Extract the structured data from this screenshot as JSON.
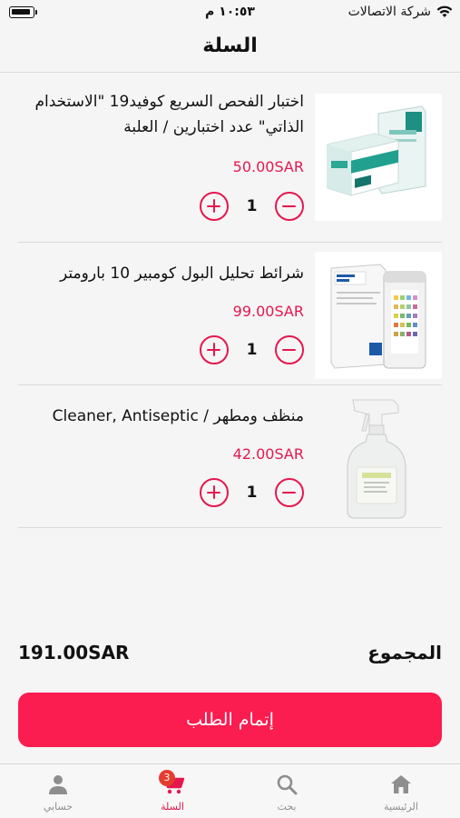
{
  "status_bar": {
    "carrier": "شركة الاتصالات",
    "time": "١٠:٥٣ م"
  },
  "header": {
    "title": "السلة"
  },
  "cart": {
    "items": [
      {
        "name": "اختبار الفحص السريع كوفيد19 \"الاستخدام الذاتي\"  عدد اختبارين / العلبة",
        "price": "50.00SAR",
        "quantity": "1",
        "image": "covid-test-kit-image"
      },
      {
        "name": "شرائط تحليل البول كومبير 10 بارومتر",
        "price": "99.00SAR",
        "quantity": "1",
        "image": "urine-test-strips-image"
      },
      {
        "name": "منظف ومطهر / Cleaner, Antiseptic",
        "price": "42.00SAR",
        "quantity": "1",
        "image": "spray-bottle-image"
      }
    ]
  },
  "summary": {
    "total_label": "المجموع",
    "total_value": "191.00SAR",
    "checkout_label": "إتمام الطلب"
  },
  "tab_bar": {
    "items": [
      {
        "label": "الرئيسية",
        "icon": "home-icon"
      },
      {
        "label": "بحث",
        "icon": "search-icon"
      },
      {
        "label": "السلة",
        "icon": "cart-icon",
        "badge": "3",
        "active": true
      },
      {
        "label": "حسابي",
        "icon": "person-icon"
      }
    ]
  },
  "colors": {
    "accent": "#e5174f",
    "checkout_button": "#fb1c50",
    "badge": "#e63c2f"
  }
}
